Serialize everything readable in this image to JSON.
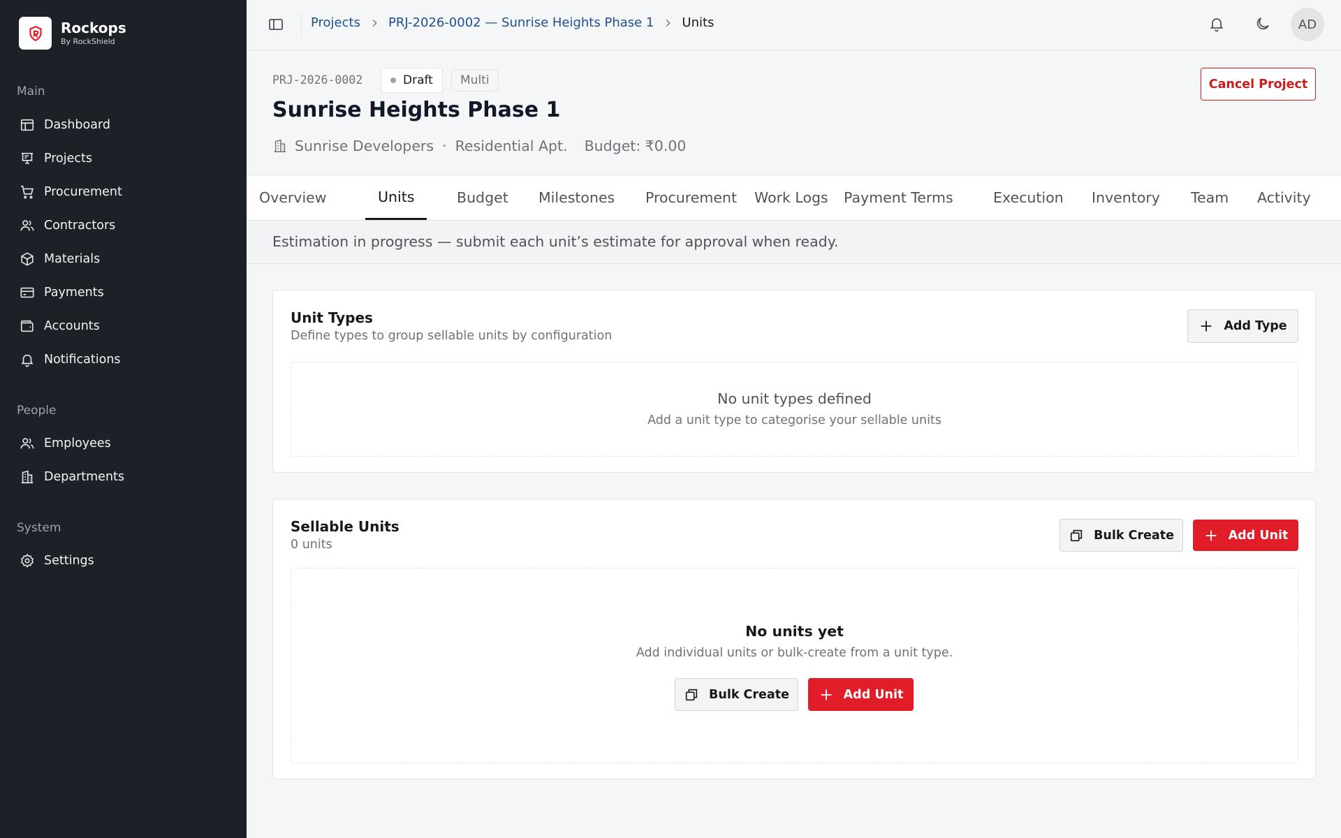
{
  "brand": {
    "name": "Rockops",
    "subtitle": "By RockShield"
  },
  "sidebar": {
    "sections": [
      {
        "label": "Main"
      },
      {
        "label": "People"
      },
      {
        "label": "System"
      }
    ],
    "items": [
      {
        "label": "Dashboard",
        "icon": "dashboard-icon"
      },
      {
        "label": "Projects",
        "icon": "presentation-icon"
      },
      {
        "label": "Procurement",
        "icon": "cart-icon"
      },
      {
        "label": "Contractors",
        "icon": "users-icon"
      },
      {
        "label": "Materials",
        "icon": "box-icon"
      },
      {
        "label": "Payments",
        "icon": "credit-card-icon"
      },
      {
        "label": "Accounts",
        "icon": "wallet-icon"
      },
      {
        "label": "Notifications",
        "icon": "bell-icon"
      },
      {
        "label": "Employees",
        "icon": "users-icon"
      },
      {
        "label": "Departments",
        "icon": "building-icon"
      },
      {
        "label": "Settings",
        "icon": "gear-icon"
      }
    ]
  },
  "breadcrumb": {
    "items": [
      "Projects",
      "PRJ-2026-0002 — Sunrise Heights Phase 1"
    ],
    "current": "Units"
  },
  "topbar": {
    "avatar_initials": "AD"
  },
  "project": {
    "code": "PRJ-2026-0002",
    "status": "Draft",
    "mode": "Multi",
    "title": "Sunrise Heights Phase 1",
    "developer": "Sunrise Developers",
    "separator": "·",
    "type": "Residential Apt.",
    "budget": "Budget: ₹0.00",
    "cancel_label": "Cancel Project"
  },
  "tabs": [
    {
      "label": "Overview"
    },
    {
      "label": "Units",
      "active": true
    },
    {
      "label": "Budget"
    },
    {
      "label": "Milestones"
    },
    {
      "label": "Procurement"
    },
    {
      "label": "Work Logs"
    },
    {
      "label": "Payment Terms"
    },
    {
      "label": "Execution"
    },
    {
      "label": "Inventory"
    },
    {
      "label": "Team"
    },
    {
      "label": "Activity"
    }
  ],
  "notice": "Estimation in progress — submit each unit’s estimate for approval when ready.",
  "unit_types": {
    "title": "Unit Types",
    "subtitle": "Define types to group sellable units by configuration",
    "add_label": "Add Type",
    "empty_title": "No unit types defined",
    "empty_sub": "Add a unit type to categorise your sellable units"
  },
  "sellable_units": {
    "title": "Sellable Units",
    "count": "0 units",
    "bulk_label": "Bulk Create",
    "add_label": "Add Unit",
    "empty_title": "No units yet",
    "empty_sub": "Add individual units or bulk-create from a unit type.",
    "empty_bulk_label": "Bulk Create",
    "empty_add_label": "Add Unit"
  },
  "colors": {
    "sidebar": "#1c2027",
    "accent_red": "#e11d2a",
    "danger": "#c81e1e",
    "link": "#1d4f91"
  }
}
